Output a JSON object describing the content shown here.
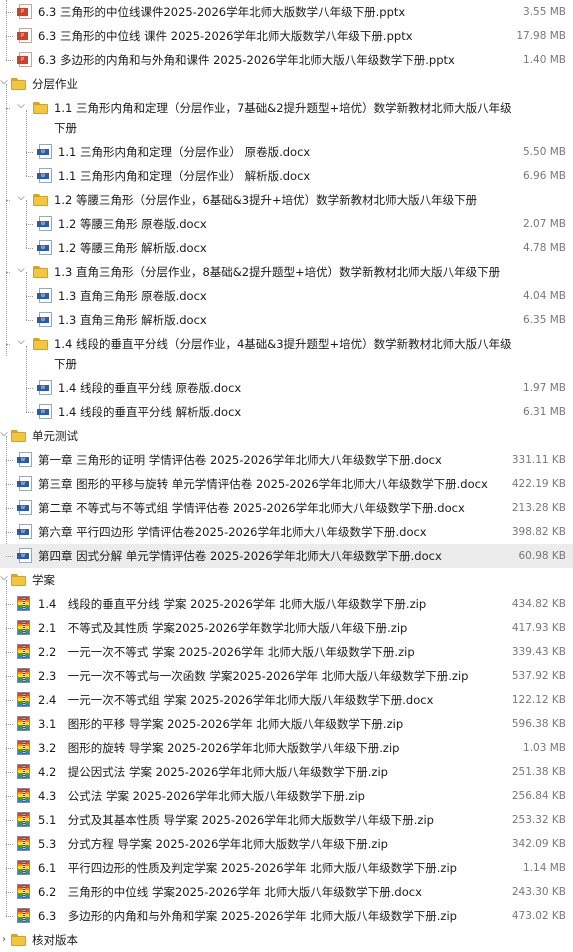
{
  "rows": [
    {
      "name": "6.3 三角形的中位线课件2025-2026学年北师大版数学八年级下册.pptx",
      "size": "3.55 MB",
      "icon": "ppt"
    },
    {
      "name": "6.3 三角形的中位线 课件 2025-2026学年北师大版数学八年级下册.pptx",
      "size": "17.98 MB",
      "icon": "ppt"
    },
    {
      "name": "6.3 多边形的内角和与外角和课件 2025-2026学年北师大版八年级数学下册.pptx",
      "size": "1.40 MB",
      "icon": "ppt"
    },
    {
      "name": "分层作业",
      "size": "",
      "icon": "folder"
    },
    {
      "name": "1.1 三角形内角和定理（分层作业，7基础&2提升题型+培优）数学新教材北师大版八年级下册",
      "size": "",
      "icon": "folder"
    },
    {
      "name": "1.1 三角形内角和定理（分层作业） 原卷版.docx",
      "size": "5.50 MB",
      "icon": "doc"
    },
    {
      "name": "1.1 三角形内角和定理（分层作业） 解析版.docx",
      "size": "6.96 MB",
      "icon": "doc"
    },
    {
      "name": "1.2 等腰三角形（分层作业，6基础&3提升+培优）数学新教材北师大版八年级下册",
      "size": "",
      "icon": "folder"
    },
    {
      "name": "1.2 等腰三角形 原卷版.docx",
      "size": "2.07 MB",
      "icon": "doc"
    },
    {
      "name": "1.2 等腰三角形 解析版.docx",
      "size": "4.78 MB",
      "icon": "doc"
    },
    {
      "name": "1.3 直角三角形（分层作业，8基础&2提升题型+培优）数学新教材北师大版八年级下册",
      "size": "",
      "icon": "folder"
    },
    {
      "name": "1.3 直角三角形 原卷版.docx",
      "size": "4.04 MB",
      "icon": "doc"
    },
    {
      "name": "1.3 直角三角形 解析版.docx",
      "size": "6.35 MB",
      "icon": "doc"
    },
    {
      "name": "1.4 线段的垂直平分线（分层作业，4基础&3提升题型+培优）数学新教材北师大版八年级下册",
      "size": "",
      "icon": "folder"
    },
    {
      "name": "1.4 线段的垂直平分线 原卷版.docx",
      "size": "1.97 MB",
      "icon": "doc"
    },
    {
      "name": "1.4 线段的垂直平分线 解析版.docx",
      "size": "6.31 MB",
      "icon": "doc"
    },
    {
      "name": "单元测试",
      "size": "",
      "icon": "folder"
    },
    {
      "name": "第一章 三角形的证明 学情评估卷 2025-2026学年北师大八年级数学下册.docx",
      "size": "331.11 KB",
      "icon": "doc"
    },
    {
      "name": "第三章 图形的平移与旋转 单元学情评估卷 2025-2026学年北师大八年级数学下册.docx",
      "size": "422.19 KB",
      "icon": "doc"
    },
    {
      "name": "第二章 不等式与不等式组 学情评估卷 2025-2026学年北师大八年级数学下册.docx",
      "size": "213.28 KB",
      "icon": "doc"
    },
    {
      "name": "第六章 平行四边形 学情评估卷2025-2026学年北师大八年级数学下册.docx",
      "size": "398.82 KB",
      "icon": "doc"
    },
    {
      "name": "第四章 因式分解 单元学情评估卷 2025-2026学年北师大八年级数学下册.docx",
      "size": "60.98 KB",
      "icon": "doc"
    },
    {
      "name": "学案",
      "size": "",
      "icon": "folder"
    },
    {
      "name": "1.4　线段的垂直平分线 学案 2025-2026学年 北师大版八年级数学下册.zip",
      "size": "434.82 KB",
      "icon": "zip"
    },
    {
      "name": "2.1　不等式及其性质 学案2025-2026学年数学北师大版八年级下册.zip",
      "size": "417.93 KB",
      "icon": "zip"
    },
    {
      "name": "2.2　一元一次不等式 学案 2025-2026学年 北师大版八年级数学下册.zip",
      "size": "339.43 KB",
      "icon": "zip"
    },
    {
      "name": "2.3　一元一次不等式与一次函数 学案2025-2026学年 北师大版八年级数学下册.zip",
      "size": "537.92 KB",
      "icon": "zip"
    },
    {
      "name": "2.4　一元一次不等式组 学案 2025-2026学年北师大版八年级数学下册.docx",
      "size": "122.12 KB",
      "icon": "zip"
    },
    {
      "name": "3.1　图形的平移 导学案 2025-2026学年 北师大版八年级数学下册.zip",
      "size": "596.38 KB",
      "icon": "zip"
    },
    {
      "name": "3.2　图形的旋转 导学案 2025-2026学年北师大版数学八年级下册.zip",
      "size": "1.03 MB",
      "icon": "zip"
    },
    {
      "name": "4.2　提公因式法 学案 2025-2026学年北师大版八年级数学下册.zip",
      "size": "251.38 KB",
      "icon": "zip"
    },
    {
      "name": "4.3　公式法 学案 2025-2026学年北师大版八年级数学下册.zip",
      "size": "256.84 KB",
      "icon": "zip"
    },
    {
      "name": "5.1　分式及其基本性质 导学案 2025-2026学年北师大版数学八年级下册.zip",
      "size": "253.32 KB",
      "icon": "zip"
    },
    {
      "name": "5.3　分式方程 导学案 2025-2026学年北师大版数学八年级下册.zip",
      "size": "342.09 KB",
      "icon": "zip"
    },
    {
      "name": "6.1　平行四边形的性质及判定学案 2025-2026学年 北师大版八年级数学下册.zip",
      "size": "1.14 MB",
      "icon": "zip"
    },
    {
      "name": "6.2　三角形的中位线 学案2025-2026学年 北师大版八年级数学下册.docx",
      "size": "243.30 KB",
      "icon": "zip"
    },
    {
      "name": "6.3　多边形的内角和与外角和学案 2025-2026学年 北师大版八年级数学下册.zip",
      "size": "473.02 KB",
      "icon": "zip"
    },
    {
      "name": "核对版本",
      "size": "",
      "icon": "folder"
    }
  ],
  "colors": {
    "folder": "#f3c640",
    "doc_badge": "#2b5aa8",
    "ppt_badge": "#c8432a",
    "zip_stripes": [
      "#e53935",
      "#fb8c00",
      "#fdd835",
      "#43a047",
      "#1e88e5",
      "#5e35b1"
    ],
    "selected_row": "#ececec",
    "size_text": "#777777"
  }
}
